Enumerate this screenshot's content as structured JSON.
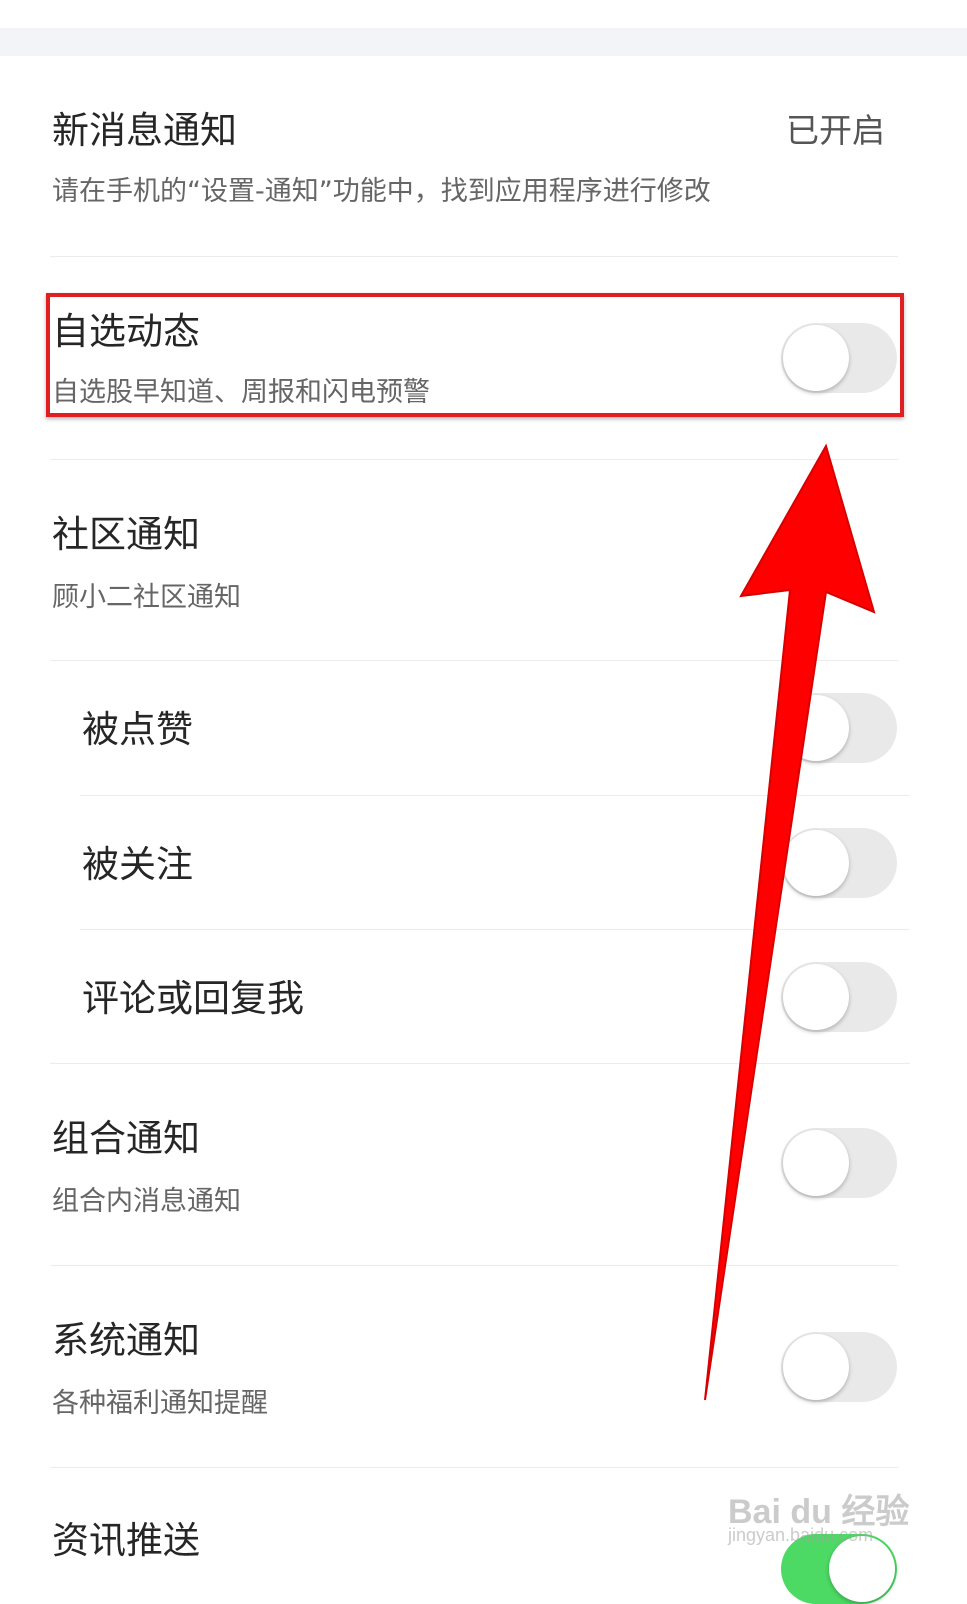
{
  "new_message": {
    "title": "新消息通知",
    "status": "已开启",
    "description": "请在手机的“设置-通知”功能中，找到应用程序进行修改"
  },
  "items": [
    {
      "title": "自选动态",
      "subtitle": "自选股早知道、周报和闪电预警",
      "enabled": false
    },
    {
      "title": "社区通知",
      "subtitle": "顾小二社区通知"
    },
    {
      "title": "被点赞",
      "enabled": false
    },
    {
      "title": "被关注",
      "enabled": false
    },
    {
      "title": "评论或回复我",
      "enabled": false
    },
    {
      "title": "组合通知",
      "subtitle": "组合内消息通知",
      "enabled": false
    },
    {
      "title": "系统通知",
      "subtitle": "各种福利通知提醒",
      "enabled": false
    },
    {
      "title": "资讯推送",
      "enabled": true
    }
  ],
  "watermark": {
    "brand": "Bai du 经验",
    "url": "jingyan.baidu.com"
  },
  "colors": {
    "toggle_off": "#e9e9ea",
    "toggle_on": "#4cd964",
    "annotation_red": "#e02020",
    "arrow_red": "#ff0000"
  }
}
